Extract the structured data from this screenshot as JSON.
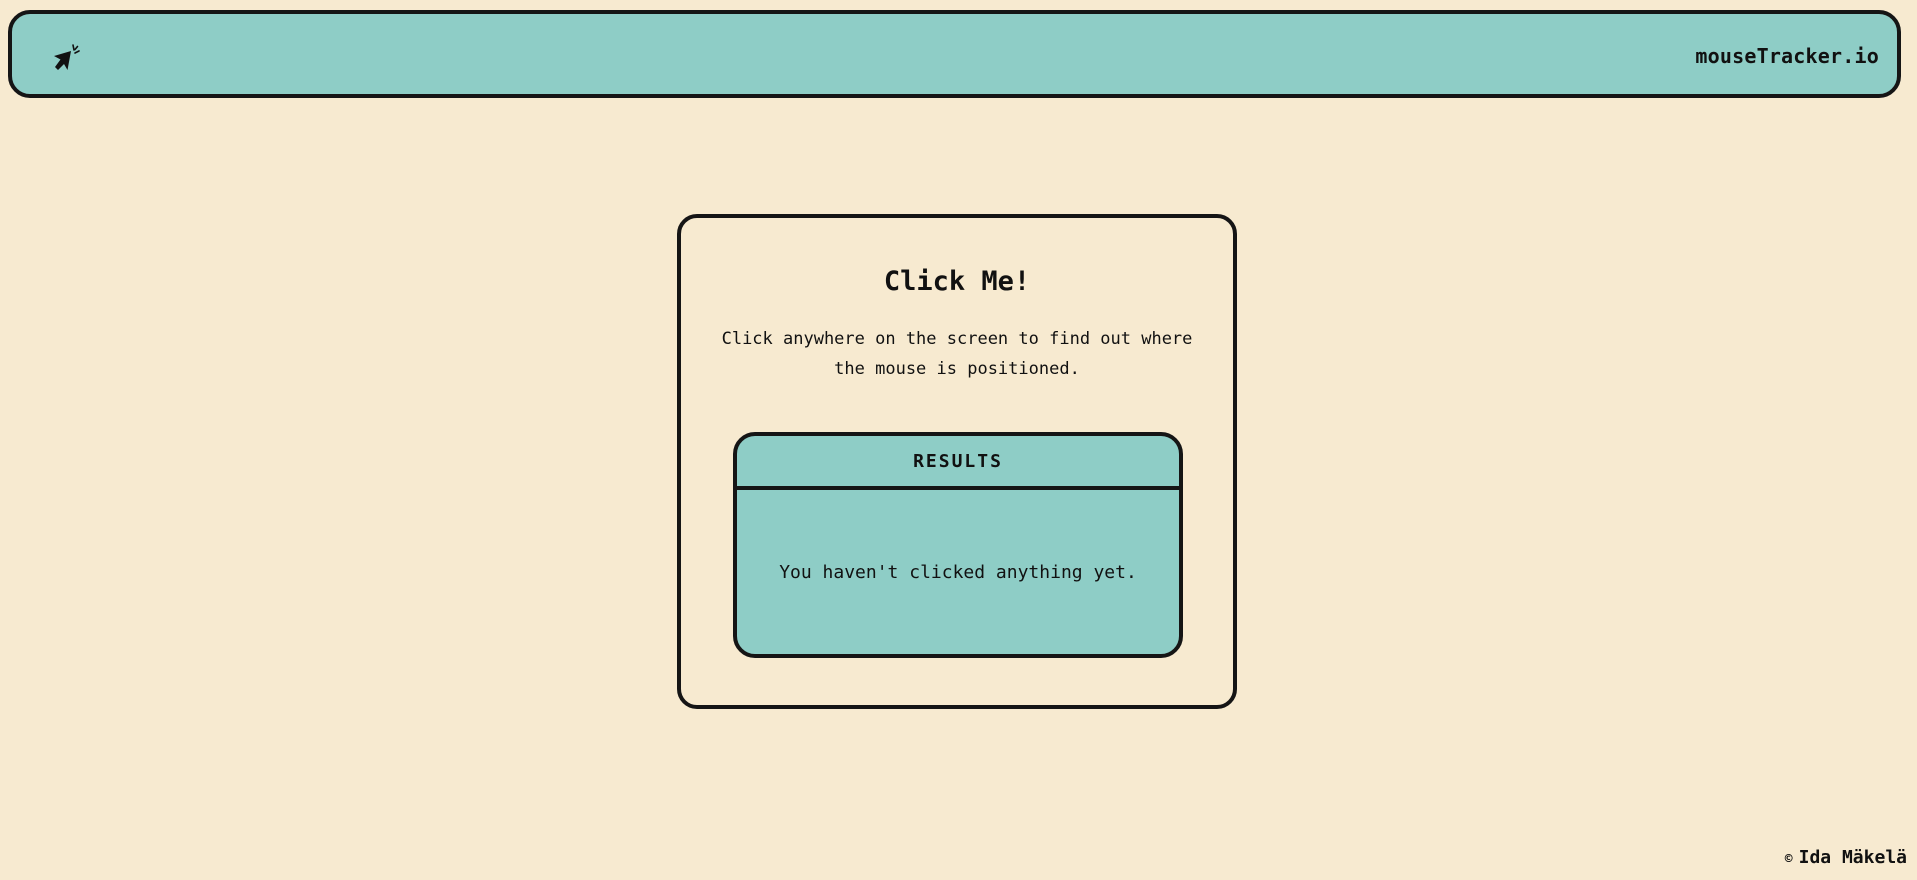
{
  "header": {
    "logo_icon": "cursor-click-icon",
    "brand": "mouseTracker.io"
  },
  "card": {
    "title": "Click Me!",
    "description": "Click anywhere on the screen to find out where the mouse is positioned."
  },
  "results": {
    "heading": "RESULTS",
    "message": "You haven't clicked anything yet."
  },
  "footer": {
    "copyright_symbol": "©",
    "author": "Ida Mäkelä"
  },
  "colors": {
    "background": "#f7ead0",
    "accent": "#8ecdc6",
    "border": "#151515"
  }
}
